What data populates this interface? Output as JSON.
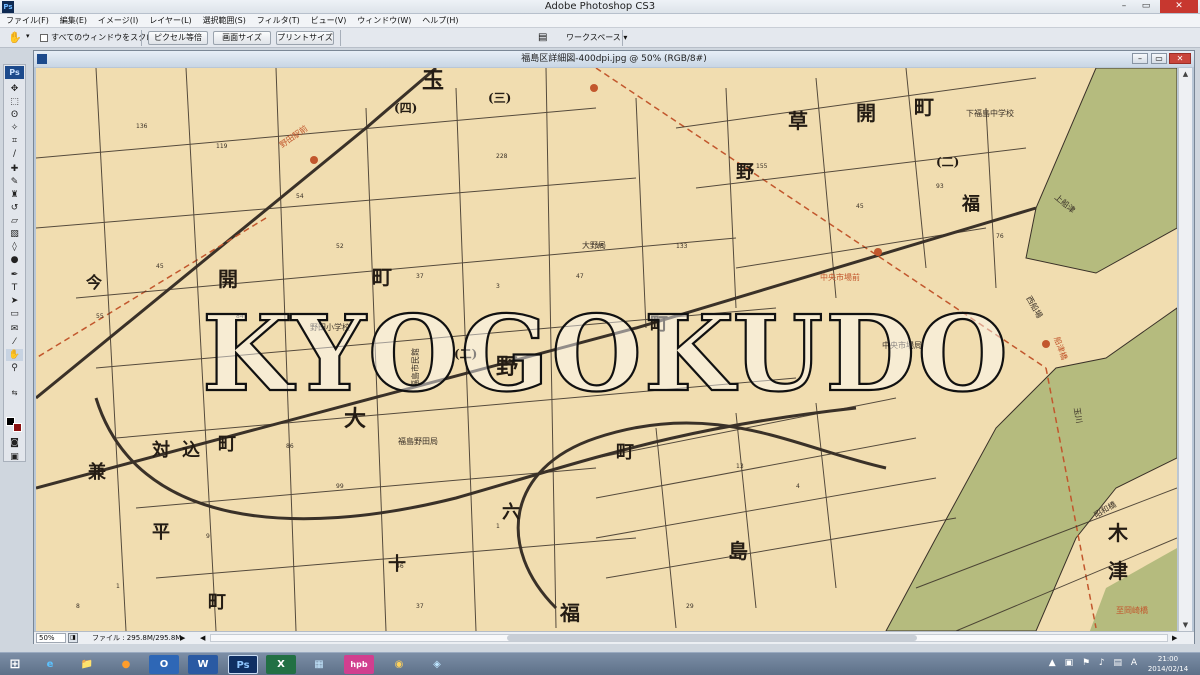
{
  "window": {
    "title": "Adobe Photoshop CS3",
    "app_icon": "Ps",
    "controls": {
      "minimize": "–",
      "maximize": "▭",
      "close": "✕"
    }
  },
  "menu": [
    "ファイル(F)",
    "編集(E)",
    "イメージ(I)",
    "レイヤー(L)",
    "選択範囲(S)",
    "フィルタ(T)",
    "ビュー(V)",
    "ウィンドウ(W)",
    "ヘルプ(H)"
  ],
  "options": {
    "tool_icon": "hand-icon",
    "scroll_all_label": "すべてのウィンドウをスクロール",
    "scroll_all_checked": false,
    "actual_pixels": "ピクセル等倍",
    "fit_screen": "画面サイズ",
    "print_size": "プリントサイズ",
    "workspace": "ワークスペース ▾"
  },
  "toolbox": {
    "badge": "Ps",
    "fg_color": "#000000",
    "bg_color": "#8a1010"
  },
  "document": {
    "title": "福島区詳細図-400dpi.jpg @ 50% (RGB/8#)",
    "watermark": "KYOGOKUDO",
    "zoom": "50%",
    "file_info": "ファイル : 295.8M/295.8M",
    "map": {
      "large_labels": [
        "玉",
        "(四)",
        "(三)",
        "草",
        "開",
        "町",
        "福",
        "(二)",
        "開",
        "町",
        "大",
        "対",
        "込",
        "町",
        "兼",
        "平",
        "町",
        "野",
        "(二)",
        "野",
        "町",
        "町",
        "島",
        "六",
        "十",
        "福",
        "木",
        "津",
        "今"
      ],
      "station_labels": [
        "野田駅前",
        "中央市場前",
        "中央市場局",
        "大野局",
        "福島市民館",
        "福島野田局",
        "野田小学校",
        "下福島中学校",
        "至岡崎橋",
        "昭和橋",
        "船津橋",
        "西船場",
        "上船津",
        "玉川"
      ],
      "colors": {
        "paper": "#f1ddb0",
        "river": "#b5bb7e",
        "road": "#3a3128",
        "rail": "#c2572d"
      }
    }
  },
  "taskbar": {
    "start_icon": "windows-logo-icon",
    "apps": [
      "e",
      "📁",
      "●",
      "O",
      "W",
      "Ps",
      "X",
      "▦",
      "hpb",
      "◉",
      "◈"
    ],
    "tray_icons": "▲ ▣ ⚑ ♪ ▤ A",
    "time": "21:00",
    "date": "2014/02/14"
  }
}
